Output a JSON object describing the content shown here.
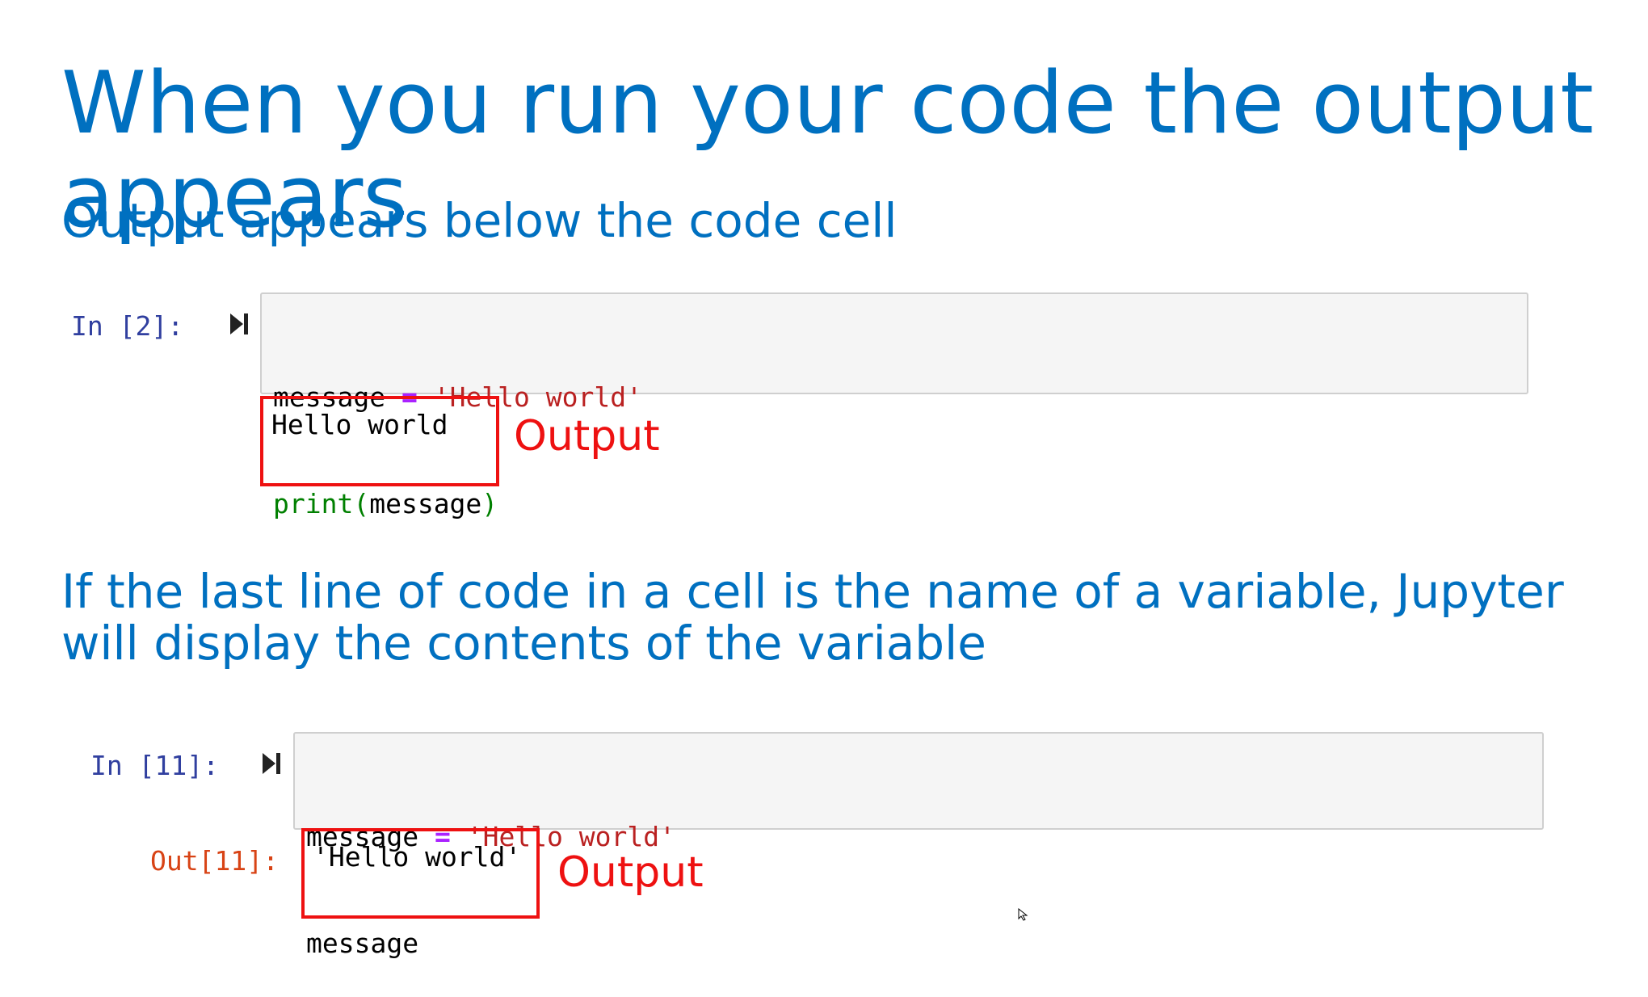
{
  "slide": {
    "title": "When you run your code the output appears",
    "subtitle": "Output appears below the code cell",
    "body_text": "If the last line of code in a cell is the name of a variable, Jupyter will display the contents of the variable"
  },
  "cell1": {
    "prompt": "In [2]:",
    "line1": {
      "var": "message",
      "op": "=",
      "str": "'Hello world'"
    },
    "line2": {
      "func": "print",
      "open": "(",
      "arg": "message",
      "close": ")"
    },
    "output": "Hello world",
    "output_label": "Output"
  },
  "cell2": {
    "prompt": "In [11]:",
    "line1": {
      "var": "message",
      "op": "=",
      "str": "'Hello world'"
    },
    "line2": "message",
    "out_prompt": "Out[11]:",
    "output": "'Hello world'",
    "output_label": "Output"
  },
  "colors": {
    "heading_blue": "#0070c0",
    "output_red": "#ee1111",
    "in_prompt": "#303f9f",
    "out_prompt": "#d84315",
    "cell_bg": "#f5f5f5"
  },
  "icons": {
    "run": "run-cell-icon",
    "cursor": "mouse-cursor-icon"
  }
}
